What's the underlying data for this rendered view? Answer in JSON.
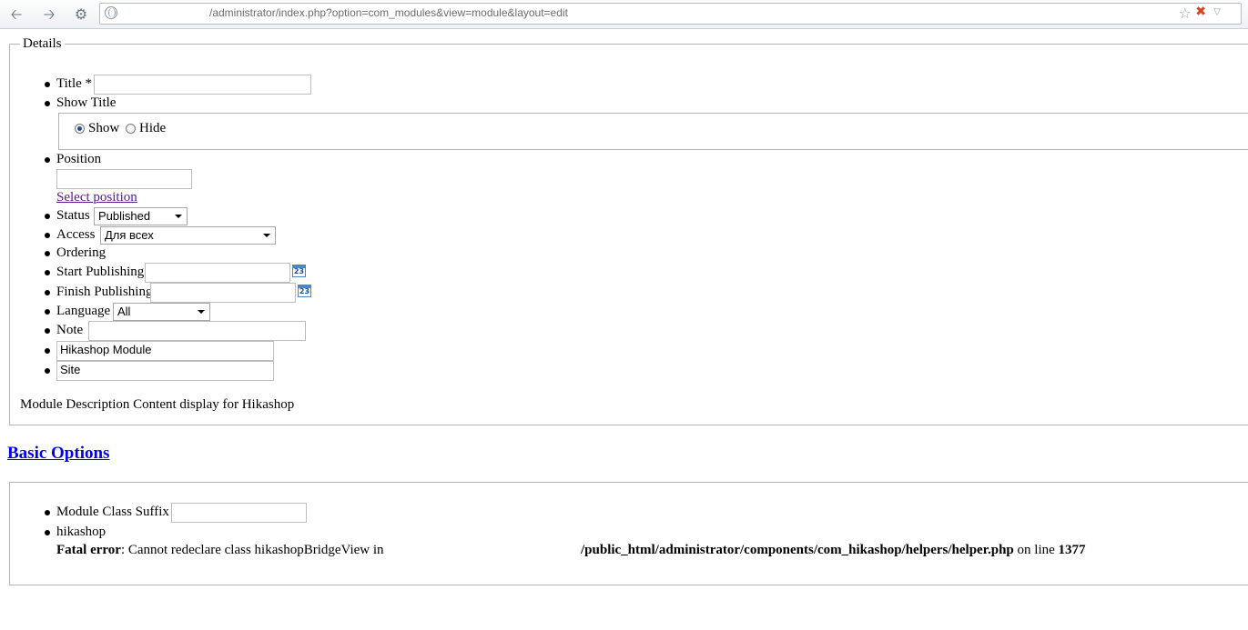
{
  "browser": {
    "url": "/administrator/index.php?option=com_modules&view=module&layout=edit",
    "icons": [
      "back-icon",
      "forward-icon",
      "extensions-icon",
      "globe-icon",
      "star-icon",
      "stop-icon",
      "dropdown-icon"
    ]
  },
  "details": {
    "legend": "Details",
    "title_label": "Title *",
    "title_value": "",
    "show_title_label": "Show Title",
    "show_option": "Show",
    "hide_option": "Hide",
    "show_title_selected": "Show",
    "position_label": "Position",
    "position_value": "",
    "select_position_link": "Select position",
    "status_label": "Status",
    "status_value": "Published",
    "access_label": "Access",
    "access_value": "Для всех",
    "ordering_label": "Ordering",
    "start_publishing_label": "Start Publishing",
    "start_publishing_value": "",
    "finish_publishing_label": "Finish Publishing",
    "finish_publishing_value": "",
    "calendar_icon_text": "23",
    "language_label": "Language",
    "language_value": "All",
    "note_label": "Note",
    "note_value": "",
    "module_type_value": "Hikashop Module",
    "client_value": "Site",
    "module_description": "Module Description Content display for Hikashop"
  },
  "basic_options": {
    "heading": "Basic Options",
    "class_suffix_label": "Module Class Suffix",
    "class_suffix_value": "",
    "hikashop_label": "hikashop",
    "error_label": "Fatal error",
    "error_message": ": Cannot redeclare class hikashopBridgeView in",
    "error_path": "/public_html/administrator/components/com_hikashop/helpers/helper.php",
    "error_on_line": "on line",
    "error_line_number": "1377"
  }
}
